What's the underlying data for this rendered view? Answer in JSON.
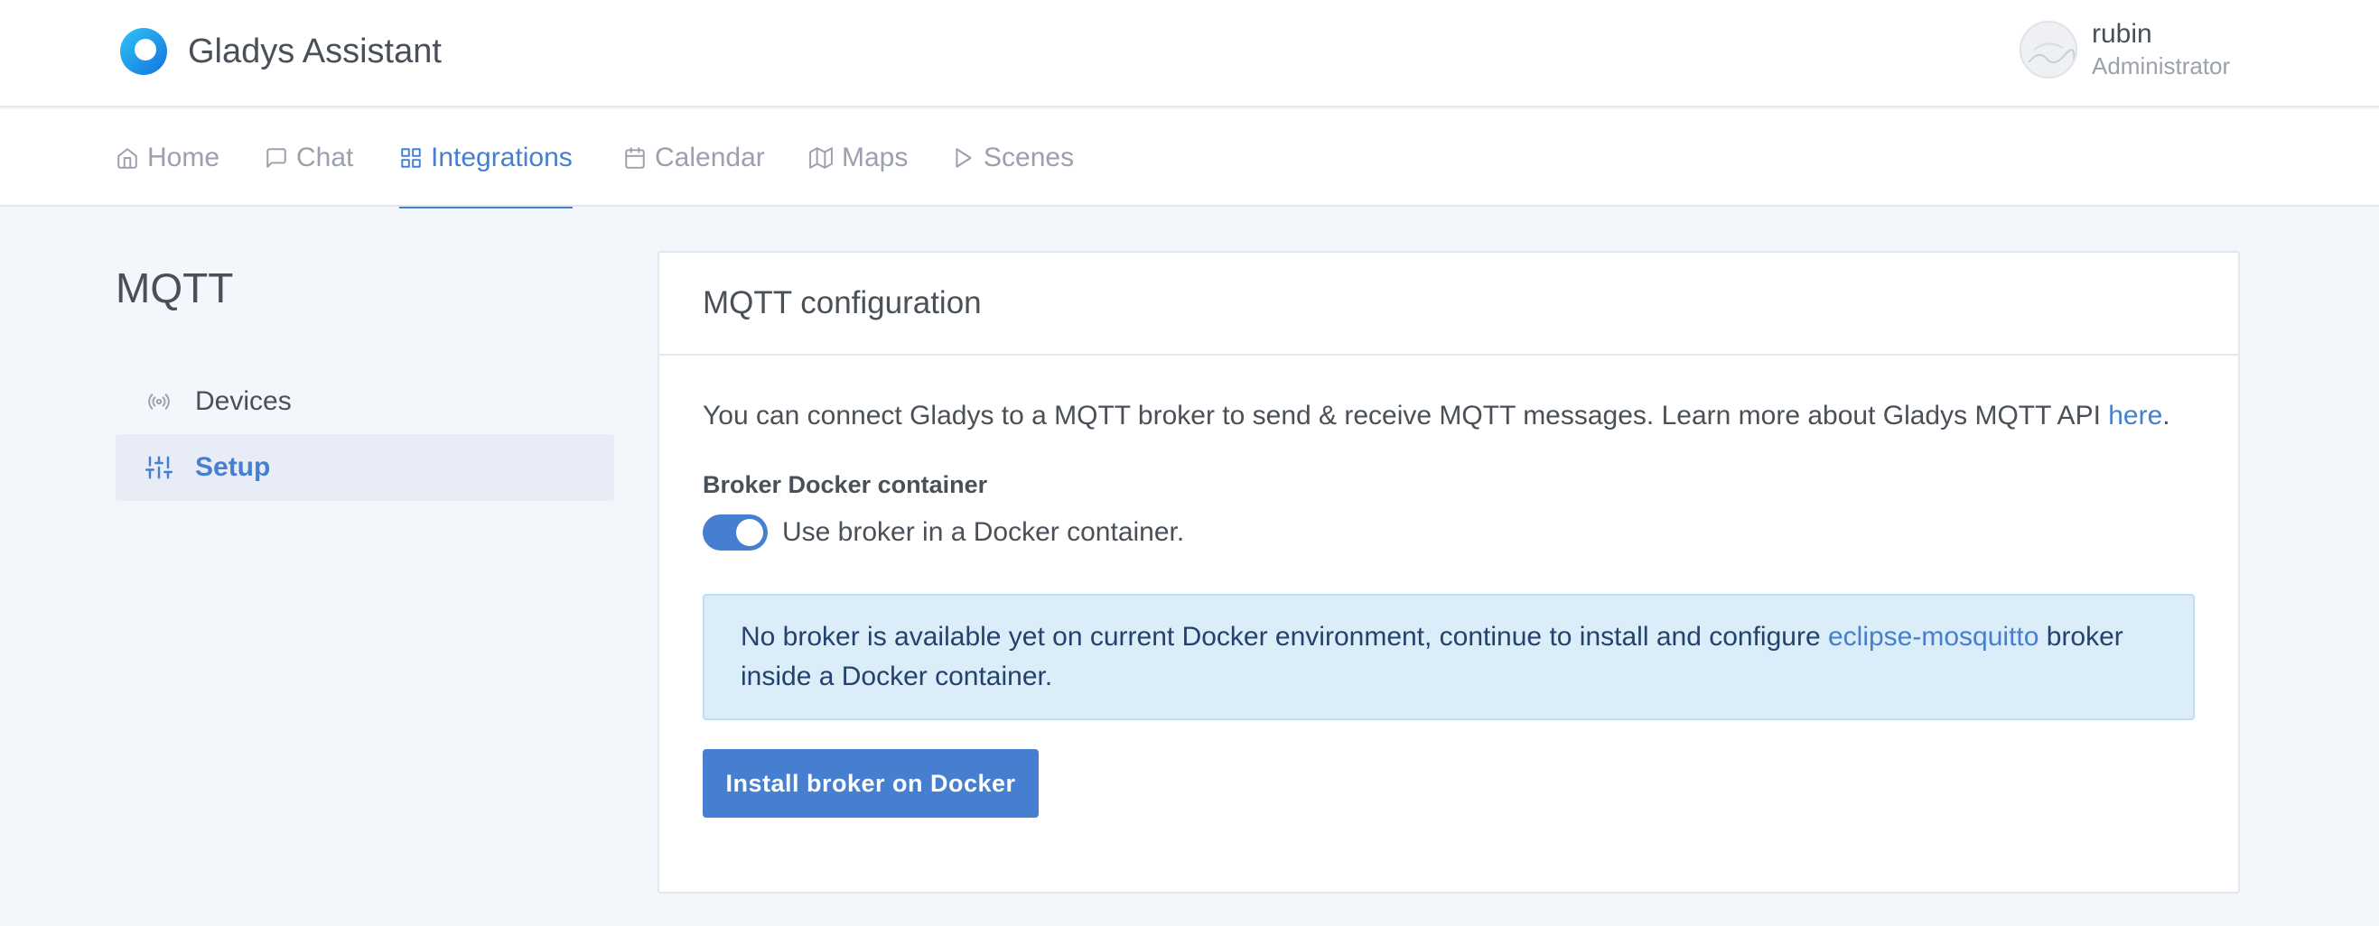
{
  "app": {
    "name": "Gladys Assistant"
  },
  "user": {
    "name": "rubin",
    "role": "Administrator"
  },
  "nav": {
    "items": [
      {
        "label": "Home",
        "icon": "home-icon"
      },
      {
        "label": "Chat",
        "icon": "chat-icon"
      },
      {
        "label": "Integrations",
        "icon": "grid-icon",
        "active": true
      },
      {
        "label": "Calendar",
        "icon": "calendar-icon"
      },
      {
        "label": "Maps",
        "icon": "map-icon"
      },
      {
        "label": "Scenes",
        "icon": "play-icon"
      }
    ]
  },
  "sidebar": {
    "title": "MQTT",
    "items": [
      {
        "label": "Devices",
        "icon": "radio-icon"
      },
      {
        "label": "Setup",
        "icon": "sliders-icon",
        "active": true
      }
    ]
  },
  "card": {
    "title": "MQTT configuration",
    "intro_text": "You can connect Gladys to a MQTT broker to send & receive MQTT messages. Learn more about Gladys MQTT API ",
    "intro_link": "here",
    "intro_end": ".",
    "docker_label": "Broker Docker container",
    "toggle_label": "Use broker in a Docker container.",
    "toggle_on": true,
    "alert_text_1": "No broker is available yet on current Docker environment, continue to install and configure ",
    "alert_link": "eclipse-mosquitto",
    "alert_text_2": " broker inside a Docker container.",
    "install_button": "Install broker on Docker"
  },
  "colors": {
    "accent": "#467fcf",
    "background": "#f3f6fb",
    "alert_bg": "#daedf8"
  }
}
